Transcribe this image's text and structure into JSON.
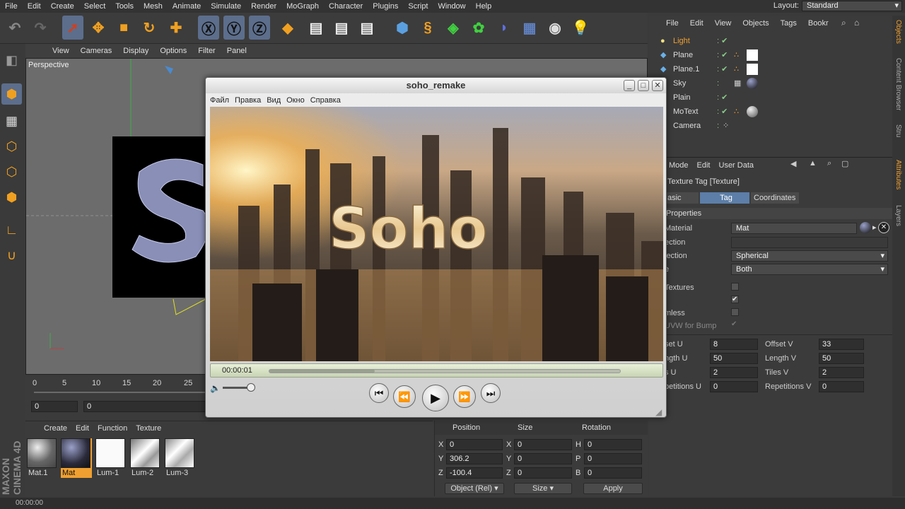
{
  "menubar": {
    "items": [
      "File",
      "Edit",
      "Create",
      "Select",
      "Tools",
      "Mesh",
      "Animate",
      "Simulate",
      "Render",
      "MoGraph",
      "Character",
      "Plugins",
      "Script",
      "Window",
      "Help"
    ],
    "layout_label": "Layout:",
    "layout_value": "Standard"
  },
  "viewport": {
    "menu": [
      "View",
      "Cameras",
      "Display",
      "Options",
      "Filter",
      "Panel"
    ],
    "label": "Perspective"
  },
  "timeline": {
    "ticks": [
      "0",
      "5",
      "10",
      "15",
      "20",
      "25"
    ],
    "start_frame": "0",
    "slider_value": "0"
  },
  "material_manager": {
    "menu": [
      "Create",
      "Edit",
      "Function",
      "Texture"
    ],
    "materials": [
      {
        "name": "Mat.1",
        "selected": false
      },
      {
        "name": "Mat",
        "selected": true
      },
      {
        "name": "Lum-1",
        "selected": false
      },
      {
        "name": "Lum-2",
        "selected": false
      },
      {
        "name": "Lum-3",
        "selected": false
      }
    ],
    "brand": "MAXON CINEMA 4D"
  },
  "coordinates": {
    "headers": [
      "Position",
      "Size",
      "Rotation"
    ],
    "rows": [
      {
        "p_axis": "X",
        "p_val": "0",
        "s_axis": "X",
        "s_val": "0",
        "r_axis": "H",
        "r_val": "0"
      },
      {
        "p_axis": "Y",
        "p_val": "306.2",
        "s_axis": "Y",
        "s_val": "0",
        "r_axis": "P",
        "r_val": "0"
      },
      {
        "p_axis": "Z",
        "p_val": "-100.4",
        "s_axis": "Z",
        "s_val": "0",
        "r_axis": "B",
        "r_val": "0"
      }
    ],
    "mode_select": "Object (Rel)",
    "size_select": "Size",
    "apply_label": "Apply"
  },
  "object_manager": {
    "menu": [
      "File",
      "Edit",
      "View",
      "Objects",
      "Tags",
      "Bookr"
    ],
    "objects": [
      "Light",
      "Plane",
      "Plane.1",
      "Sky",
      "Plain",
      "MoText",
      "Camera"
    ]
  },
  "attributes": {
    "menu": [
      "Mode",
      "Edit",
      "User Data"
    ],
    "title": "Texture Tag [Texture]",
    "tabs": [
      "asic",
      "Tag",
      "Coordinates"
    ],
    "section": "Properties",
    "material_label": "Material",
    "material_value": "Mat",
    "selection_label": "ection",
    "projection_label": "jection",
    "projection_value": "Spherical",
    "side_label": "e",
    "side_value": "Both",
    "add_textures_label": "Textures",
    "tile_label": "",
    "seamless_label": "mless",
    "uvw_bump_label": "UVW for Bump",
    "offset_u_label": "set U",
    "offset_u": "8",
    "offset_v_label": "Offset V",
    "offset_v": "33",
    "length_u_label": "ngth U",
    "length_u": "50",
    "length_v_label": "Length V",
    "length_v": "50",
    "tiles_u_label": "s U",
    "tiles_u": "2",
    "tiles_v_label": "Tiles V",
    "tiles_v": "2",
    "rep_u_label": "petitions U",
    "rep_u": "0",
    "rep_v_label": "Repetitions V",
    "rep_v": "0"
  },
  "right_strip": [
    "Objects",
    "Content Browser",
    "Stru",
    "Attributes",
    "Layers"
  ],
  "player": {
    "title": "soho_remake",
    "menu": [
      "Файл",
      "Правка",
      "Вид",
      "Окно",
      "Справка"
    ],
    "time": "00:00:01",
    "video_text": "Soho",
    "progress": 0.3
  },
  "statusbar": {
    "text": "00:00:00"
  },
  "colors": {
    "accent": "#5c6e8c",
    "highlight": "#f0a030",
    "check": "#8ccc8c"
  }
}
